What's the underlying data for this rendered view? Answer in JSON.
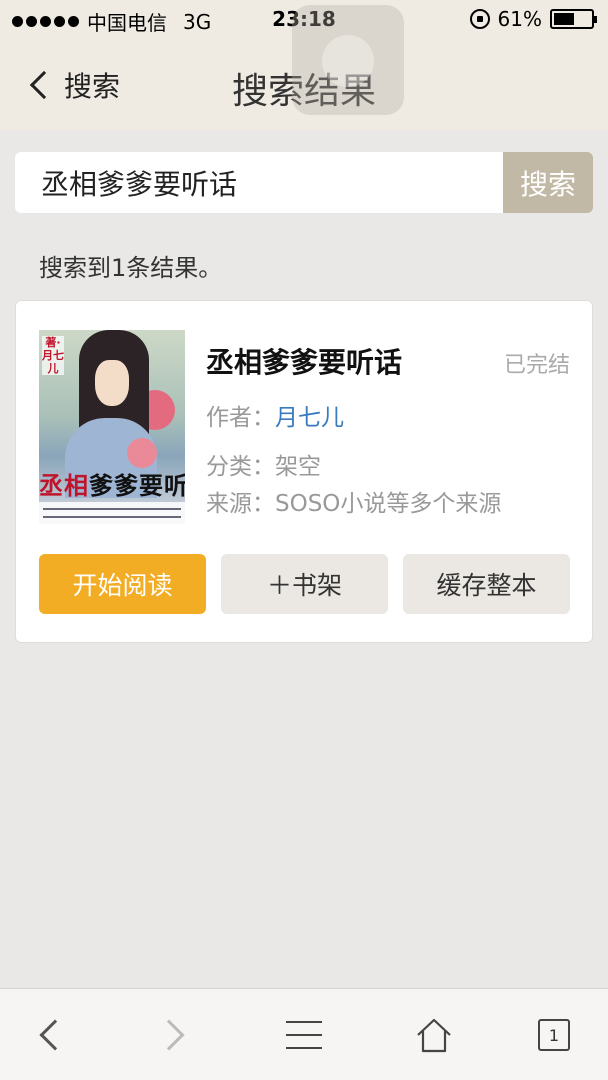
{
  "status_bar": {
    "carrier": "中国电信",
    "network": "3G",
    "time": "23:18",
    "battery": "61%",
    "battery_level": 0.61
  },
  "nav": {
    "back_label": "搜索",
    "title": "搜索结果"
  },
  "search": {
    "query": "丞相爹爹要听话",
    "button_label": "搜索"
  },
  "result_summary": "搜索到1条结果。",
  "result": {
    "cover_author_tag": "著·月七儿",
    "cover_title_red": "丞相",
    "cover_title_rest": "爹爹要听话",
    "title": "丞相爹爹要听话",
    "status": "已完结",
    "author_label": "作者：",
    "author": "月七儿",
    "category_label": "分类：",
    "category": "架空",
    "source_label": "来源：",
    "source": "SOSO小说等多个来源",
    "buttons": {
      "read": "开始阅读",
      "shelf": "＋书架",
      "cache": "缓存整本"
    }
  },
  "toolbar": {
    "tab_count": "1",
    "icons": [
      "back-icon",
      "forward-icon",
      "menu-icon",
      "home-icon",
      "tabs-icon"
    ]
  },
  "colors": {
    "accent": "#f2ad24",
    "link": "#3a7bbf",
    "search_button": "#c1b9a6"
  }
}
